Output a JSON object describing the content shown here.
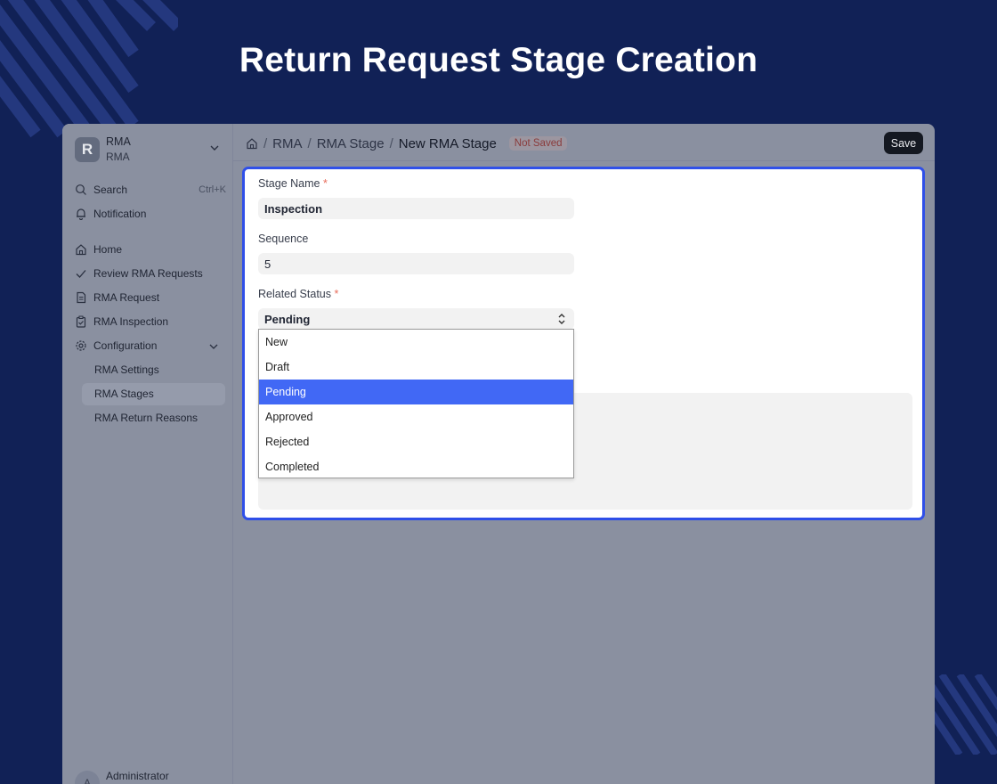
{
  "hero": {
    "title": "Return Request Stage Creation"
  },
  "workspace": {
    "logo_letter": "R",
    "name": "RMA",
    "subtitle": "RMA"
  },
  "sidebar": {
    "search_label": "Search",
    "search_shortcut": "Ctrl+K",
    "notification_label": "Notification",
    "items": [
      {
        "label": "Home",
        "icon": "home-icon"
      },
      {
        "label": "Review RMA Requests",
        "icon": "check-icon"
      },
      {
        "label": "RMA Request",
        "icon": "document-icon"
      },
      {
        "label": "RMA Inspection",
        "icon": "clipboard-icon"
      },
      {
        "label": "Configuration",
        "icon": "gear-icon"
      }
    ],
    "sub_items": [
      {
        "label": "RMA Settings",
        "active": false
      },
      {
        "label": "RMA Stages",
        "active": true
      },
      {
        "label": "RMA Return Reasons",
        "active": false
      }
    ],
    "user": {
      "name": "Administrator",
      "initial": "A"
    }
  },
  "breadcrumb": {
    "items": [
      "RMA",
      "RMA Stage"
    ],
    "current": "New RMA Stage",
    "status_badge": "Not Saved"
  },
  "toolbar": {
    "save_label": "Save"
  },
  "form": {
    "stage_name": {
      "label": "Stage Name",
      "required": "*",
      "value": "Inspection"
    },
    "sequence": {
      "label": "Sequence",
      "value": "5"
    },
    "related_status": {
      "label": "Related Status",
      "required": "*",
      "value": "Pending",
      "options": [
        "New",
        "Draft",
        "Pending",
        "Approved",
        "Rejected",
        "Completed"
      ],
      "selected_index": 2
    }
  },
  "colors": {
    "background": "#112156",
    "focus_border": "#2f4fe8",
    "option_highlight": "#4168f5",
    "required_star": "#e86c5a"
  }
}
